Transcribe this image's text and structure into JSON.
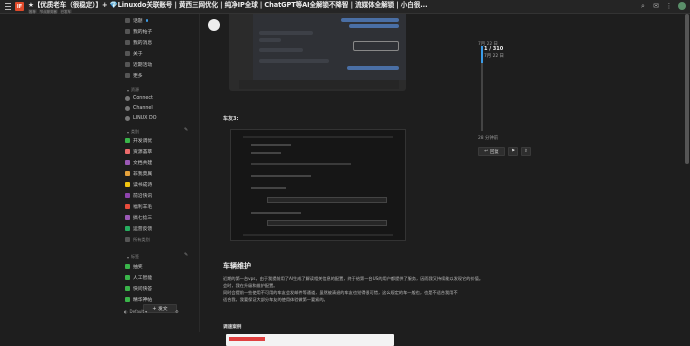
{
  "header": {
    "logo": "IF",
    "title": "★【优质老车（很稳定）】+ 💎Linuxdo关联账号 | 黄西三网优化 | 纯净IP全球 | ChatGPT等AI全解锁不降智 | 流媒体全解锁 | 小白很...",
    "tags": [
      "推荐",
      "节点服务器",
      "已发车"
    ]
  },
  "sidebar": {
    "top_items": [
      {
        "label": "话题",
        "dot": true
      },
      {
        "label": "我的帖子",
        "dot": false
      },
      {
        "label": "我的消息",
        "dot": false
      },
      {
        "label": "关于",
        "dot": false
      },
      {
        "label": "近期活动",
        "dot": false
      },
      {
        "label": "更多",
        "dot": false
      }
    ],
    "section_resources": "资源",
    "resource_items": [
      "Connect",
      "Channel",
      "LINUX DO"
    ],
    "section_categories": "类别",
    "category_items": [
      {
        "label": "开发调优",
        "color": "#3ab54a"
      },
      {
        "label": "资源荟萃",
        "color": "#ec6b6b"
      },
      {
        "label": "文档共建",
        "color": "#9b59b6"
      },
      {
        "label": "非我莫属",
        "color": "#e6a23c"
      },
      {
        "label": "读书成诗",
        "color": "#f1c40f"
      },
      {
        "label": "前沿快讯",
        "color": "#8e44ad"
      },
      {
        "label": "福利羊毛",
        "color": "#e74c3c"
      },
      {
        "label": "搞七捻三",
        "color": "#9b59b6"
      },
      {
        "label": "运营反馈",
        "color": "#27ae60"
      },
      {
        "label": "所有类别",
        "color": ""
      }
    ],
    "section_tags": "标签",
    "tag_items": [
      {
        "label": "抽奖",
        "color": "#3ab54a"
      },
      {
        "label": "人工智能",
        "color": "#3ab54a"
      },
      {
        "label": "快问快答",
        "color": "#3ab54a"
      },
      {
        "label": "精华神帖",
        "color": "#3ab54a"
      }
    ],
    "new_button": "+ 发文",
    "bottom_default": "Default"
  },
  "post": {
    "section_label": "车友3:",
    "heading": "车辆维护",
    "paragraphs": [
      "近期的第一台vps，由于我提前用了AI生成了解读相关信息的配置，终于给第一台US的用户都提供了服务，因而我又持续能以发现它的价值。",
      "会时，我在升级和维护配置。",
      "同时会提前一些使用不可用的车友会发邮件等通道，虽然被清退的车友也觉得很可惜，这么规定的车一般也，也是不适合我用不",
      "适合我，我要保证大部分车友的使用体验做第一要紧的。"
    ],
    "subheading": "调速案例"
  },
  "timeline": {
    "start_date": "7月 22 日",
    "position": "1 / 310",
    "position_date": "7月 22 日",
    "end_date": "28 分钟前"
  },
  "topic_actions": {
    "reply_label": "回复",
    "share_label": "分享"
  }
}
